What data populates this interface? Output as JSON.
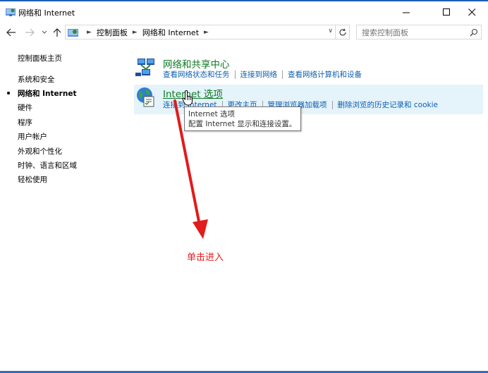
{
  "window": {
    "title": "网络和 Internet",
    "controls": {
      "minimize": "—",
      "maximize": "☐",
      "close": "✕"
    }
  },
  "navbar": {
    "back_icon": "arrow-left-icon",
    "forward_icon": "arrow-right-icon",
    "up_icon": "arrow-up-icon",
    "address_segments": [
      "控制面板",
      "网络和 Internet"
    ],
    "search_placeholder": "搜索控制面板"
  },
  "sidebar": {
    "home": "控制面板主页",
    "items": [
      {
        "label": "系统和安全",
        "active": false
      },
      {
        "label": "网络和 Internet",
        "active": true
      },
      {
        "label": "硬件",
        "active": false
      },
      {
        "label": "程序",
        "active": false
      },
      {
        "label": "用户帐户",
        "active": false
      },
      {
        "label": "外观和个性化",
        "active": false
      },
      {
        "label": "时钟、语言和区域",
        "active": false
      },
      {
        "label": "轻松使用",
        "active": false
      }
    ]
  },
  "categories": [
    {
      "title": "网络和共享中心",
      "icon": "network-sharing-icon",
      "links": [
        "查看网络状态和任务",
        "连接到网络",
        "查看网络计算机和设备"
      ]
    },
    {
      "title": "Internet 选项",
      "icon": "internet-options-icon",
      "highlighted": true,
      "links": [
        "连接到 Internet",
        "更改主页",
        "管理浏览器加载项",
        "删除浏览的历史记录和 cookie"
      ]
    }
  ],
  "tooltip": {
    "title": "Internet 选项",
    "description": "配置 Internet 显示和连接设置。"
  },
  "annotation": {
    "text": "单击进入",
    "color": "#e21b1b"
  },
  "colors": {
    "category_title": "#0c7a22",
    "link": "#0c5eb0",
    "hover_bg": "#e5f3fb",
    "window_border": "#1a5fb4"
  }
}
